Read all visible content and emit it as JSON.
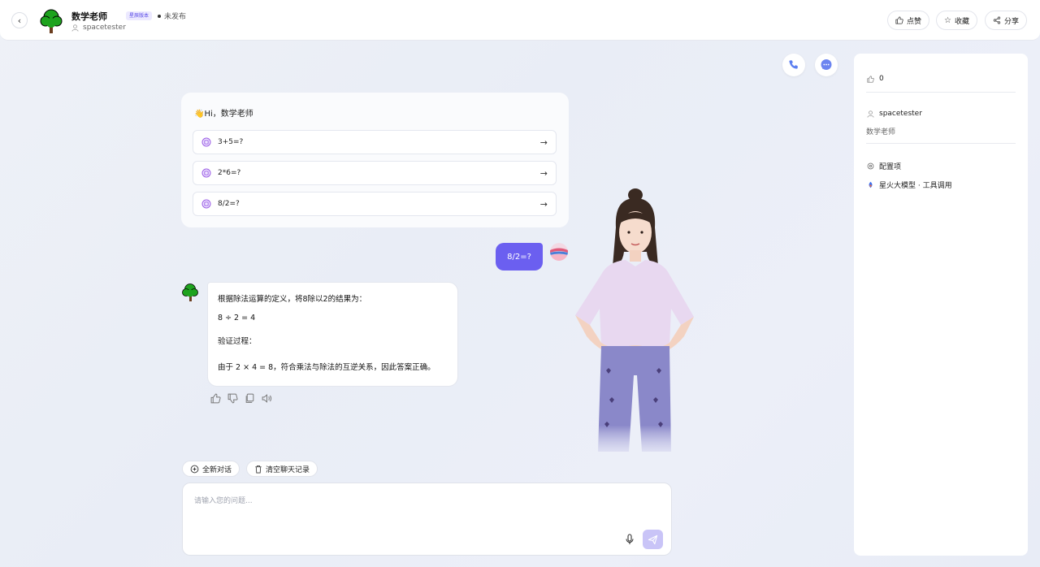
{
  "header": {
    "title": "数学老师",
    "badge": "星辰版本",
    "status": "未发布",
    "author": "spacetester",
    "buttons": {
      "like": "点赞",
      "favorite": "收藏",
      "share": "分享"
    }
  },
  "welcome": {
    "greeting": "👋Hi，数学老师",
    "suggestions": [
      {
        "text": "3+5=?"
      },
      {
        "text": "2*6=?"
      },
      {
        "text": "8/2=?"
      }
    ]
  },
  "conversation": {
    "user_message": "8/2=?",
    "bot_message": {
      "line1": "根据除法运算的定义，将8除以2的结果为：",
      "line2": "8 ÷ 2 = 4",
      "line3": "验证过程：",
      "line4": "由于 2 × 4 = 8，符合乘法与除法的互逆关系，因此答案正确。"
    }
  },
  "bottom": {
    "new_chat": "全新对话",
    "clear_history": "清空聊天记录",
    "input_placeholder": "请输入您的问题..."
  },
  "panel": {
    "likes": "0",
    "author": "spacetester",
    "description": "数学老师",
    "config_label": "配置项",
    "model": "星火大模型 · 工具调用"
  },
  "colors": {
    "accent": "#6b5ff0",
    "send_disabled": "#c9c4f7"
  }
}
